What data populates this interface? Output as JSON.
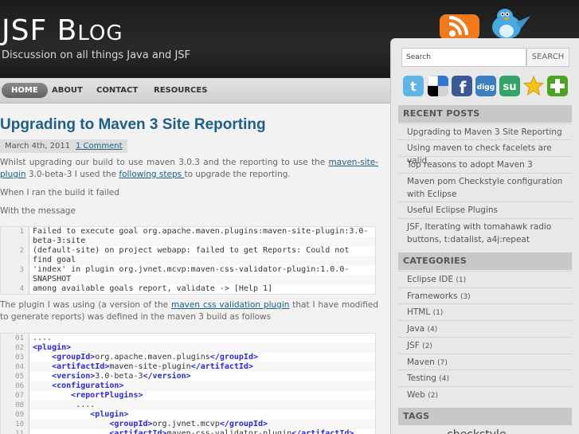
{
  "site": {
    "title_big1": "JSF B",
    "title_small": "LOG",
    "tagline": "Discussion on all things Java and JSF"
  },
  "nav": {
    "items": [
      {
        "label": "HOME"
      },
      {
        "label": "ABOUT"
      },
      {
        "label": "CONTACT"
      },
      {
        "label": "RESOURCES"
      }
    ]
  },
  "post": {
    "title": "Upgrading to Maven 3 Site Reporting",
    "date": "March 4th, 2011",
    "comments": "1 Comment",
    "p1_a": "Whilst upgrading our build to use maven 3.0.3 and the reporting to use the ",
    "p1_link": "maven-site-plugin",
    "p1_b": " 3.0-beta-3 I used the ",
    "p1_link2": "following steps ",
    "p1_c": "to upgrade the reporting.",
    "p2": "When I ran the build it failed",
    "p3": "With the message",
    "code1": [
      {
        "n": "1",
        "t": "Failed to execute goal org.apache.maven.plugins:maven-site-plugin:3.0-"
      },
      {
        "n": "",
        "t": "beta-3:site"
      },
      {
        "n": "2",
        "t": "(default-site) on project webapp: failed to get Reports: Could not"
      },
      {
        "n": "",
        "t": "find goal"
      },
      {
        "n": "3",
        "t": "'index' in plugin org.jvnet.mcvp:maven-css-validator-plugin:1.0.0-"
      },
      {
        "n": "",
        "t": "SNAPSHOT"
      },
      {
        "n": "4",
        "t": "among available goals report, validate -> [Help 1]"
      }
    ],
    "p4_a": "The plugin I was using (a version of the ",
    "p4_link": "maven css validation plugin",
    "p4_b": " that I have modified to generate reports) was defined in the maven 3 build as follows",
    "code2": [
      {
        "n": "01",
        "t": "...."
      },
      {
        "n": "02",
        "t": "<plugin>"
      },
      {
        "n": "03",
        "t": "    <groupId>org.apache.maven.plugins</groupId>"
      },
      {
        "n": "04",
        "t": "    <artifactId>maven-site-plugin</artifactId>"
      },
      {
        "n": "05",
        "t": "    <version>3.0-beta-3</version>"
      },
      {
        "n": "06",
        "t": "    <configuration>"
      },
      {
        "n": "07",
        "t": "        <reportPlugins>"
      },
      {
        "n": "08",
        "t": "         ...."
      },
      {
        "n": "09",
        "t": "            <plugin>"
      },
      {
        "n": "10",
        "t": "                <groupId>org.jvnet.mcvp</groupId>"
      },
      {
        "n": "11",
        "t": "                <artifactId>maven-css-validator-plugin</artifactId>"
      }
    ]
  },
  "sidebar": {
    "search_placeholder": "Search",
    "search_button": "SEARCH",
    "social_icons": [
      "twitter-icon",
      "delicious-icon",
      "facebook-icon",
      "digg-icon",
      "stumbleupon-icon",
      "favorite-star-icon",
      "add-plus-icon"
    ],
    "recent_title": "RECENT POSTS",
    "recent": [
      "Upgrading to Maven 3 Site Reporting",
      "Using maven to check facelets are valid",
      "Top reasons to adopt Maven 3",
      "Maven pom Checkstyle configuration with Eclipse",
      "Useful Eclipse Plugins",
      "JSF, Iterating with tomahawk radio buttons, t:datalist, a4j:repeat"
    ],
    "categories_title": "CATEGORIES",
    "categories": [
      {
        "name": "Eclipse IDE",
        "count": "(1)"
      },
      {
        "name": "Frameworks",
        "count": "(3)"
      },
      {
        "name": "HTML",
        "count": "(1)"
      },
      {
        "name": "Java",
        "count": "(4)"
      },
      {
        "name": "JSF",
        "count": "(2)"
      },
      {
        "name": "Maven",
        "count": "(7)"
      },
      {
        "name": "Testing",
        "count": "(4)"
      },
      {
        "name": "Web",
        "count": "(2)"
      }
    ],
    "tags_title": "TAGS",
    "tag_peek": "checkstyle"
  },
  "colors": {
    "link": "#1d5f86",
    "header_bg": "#1c1c1c",
    "sidebar_bg": "#e8e8e8"
  }
}
